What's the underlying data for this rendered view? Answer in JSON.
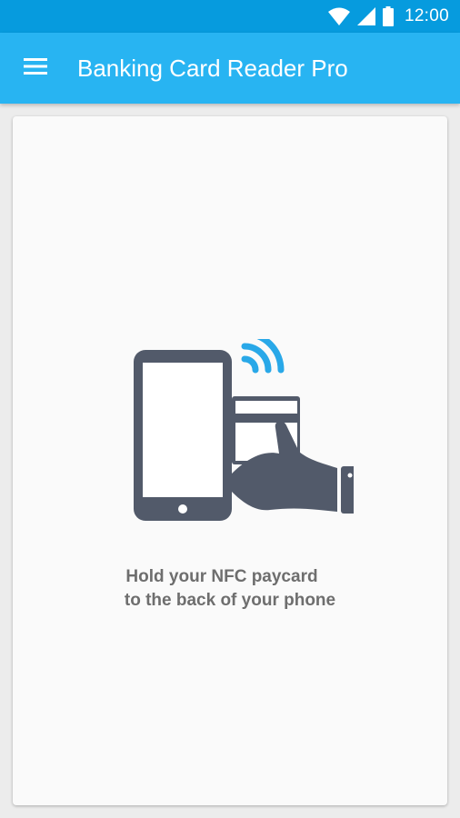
{
  "status_bar": {
    "time": "12:00",
    "icons": [
      "wifi-icon",
      "cell-signal-icon",
      "battery-icon"
    ]
  },
  "app_bar": {
    "title": "Banking Card Reader Pro",
    "menu_icon": "hamburger-menu-icon"
  },
  "main": {
    "illustration": "phone-card-nfc-illustration",
    "instruction_line_1": "Hold your NFC paycard",
    "instruction_line_2": "to the back of your phone"
  },
  "colors": {
    "status_bar": "#069bde",
    "app_bar": "#28b4f2",
    "nfc_waves": "#29a8e8",
    "illustration": "#525a6a",
    "text": "#6e6e6e"
  }
}
